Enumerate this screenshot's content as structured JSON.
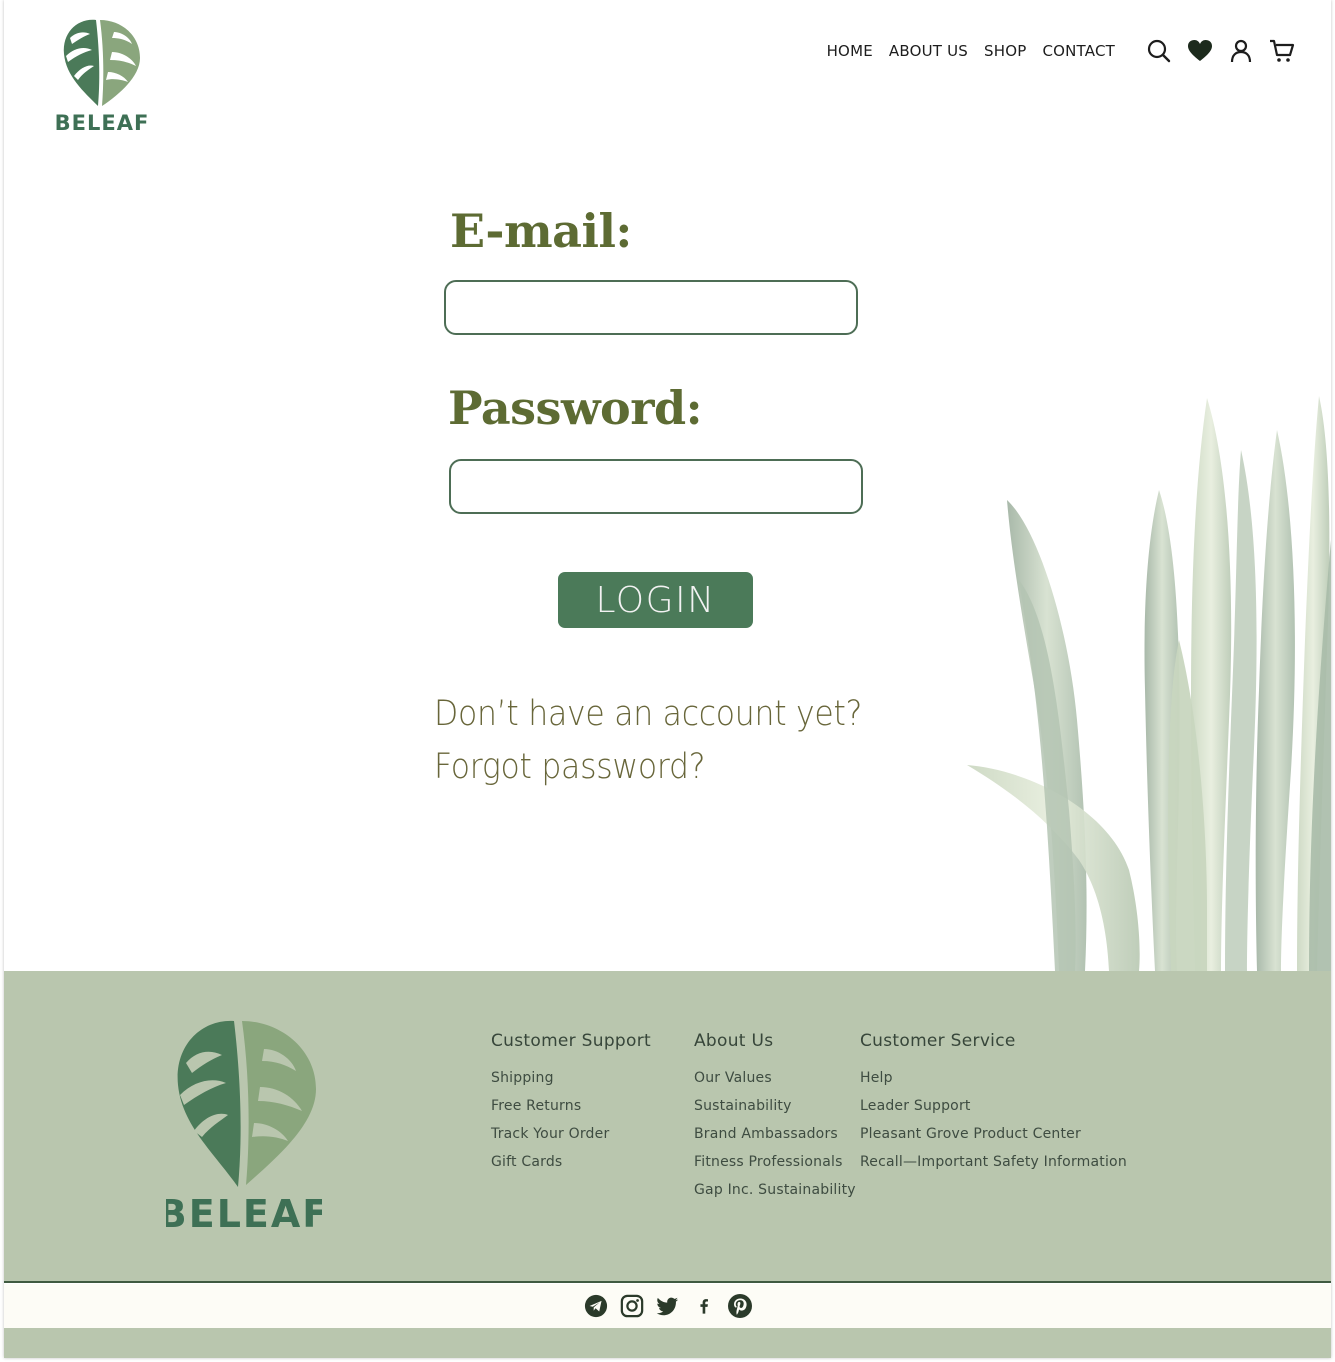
{
  "brand": {
    "name": "BELEAF",
    "colors": {
      "accent": "#4b7a59",
      "label": "#5d6b33",
      "link": "#68663a",
      "footer_bg": "#b9c6ae"
    }
  },
  "nav": {
    "items": [
      {
        "label": "HOME"
      },
      {
        "label": "ABOUT US"
      },
      {
        "label": "SHOP"
      },
      {
        "label": "CONTACT"
      }
    ],
    "icons": [
      "search-icon",
      "heart-icon",
      "user-icon",
      "cart-icon"
    ]
  },
  "form": {
    "email_label": "E-mail:",
    "email_value": "",
    "password_label": "Password:",
    "password_value": "",
    "login_label": "LOGIN",
    "signup_link": "Don’t have an account yet?",
    "forgot_link": "Forgot password?"
  },
  "footer": {
    "columns": [
      {
        "title": "Customer Support",
        "links": [
          "Shipping",
          "Free Returns",
          "Track Your Order",
          "Gift Cards"
        ]
      },
      {
        "title": "About Us",
        "links": [
          "Our Values",
          "Sustainability",
          "Brand Ambassadors",
          "Fitness Professionals",
          "Gap Inc. Sustainability"
        ]
      },
      {
        "title": "Customer Service",
        "links": [
          "Help",
          "Leader Support",
          "Pleasant Grove Product Center",
          "Recall—Important Safety Information"
        ]
      }
    ],
    "social": [
      "telegram-icon",
      "instagram-icon",
      "twitter-icon",
      "facebook-icon",
      "pinterest-icon"
    ]
  }
}
